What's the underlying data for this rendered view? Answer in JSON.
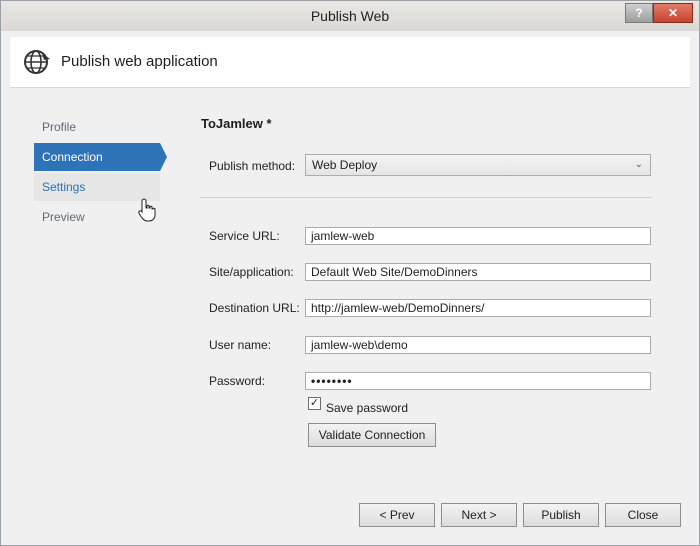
{
  "window": {
    "title": "Publish Web",
    "help_label": "?",
    "close_label": "✕"
  },
  "header": {
    "title": "Publish web application",
    "icon": "globe-publish-icon"
  },
  "nav": {
    "items": [
      {
        "label": "Profile"
      },
      {
        "label": "Connection"
      },
      {
        "label": "Settings"
      },
      {
        "label": "Preview"
      }
    ],
    "active": "Connection"
  },
  "form": {
    "profile_name": "ToJamlew *",
    "publish_method": {
      "label": "Publish method:",
      "value": "Web Deploy"
    },
    "service_url": {
      "label": "Service URL:",
      "value": "jamlew-web"
    },
    "site_application": {
      "label": "Site/application:",
      "value": "Default Web Site/DemoDinners"
    },
    "destination_url": {
      "label": "Destination URL:",
      "value": "http://jamlew-web/DemoDinners/"
    },
    "user_name": {
      "label": "User name:",
      "value": "jamlew-web\\demo"
    },
    "password": {
      "label": "Password:",
      "value": "••••••••"
    },
    "save_password": {
      "label": "Save password",
      "checked": true
    },
    "validate_label": "Validate Connection"
  },
  "footer": {
    "prev_label": "< Prev",
    "next_label": "Next >",
    "publish_label": "Publish",
    "close_label": "Close"
  },
  "colors": {
    "accent": "#2e72b8",
    "close_button": "#c7432d"
  }
}
